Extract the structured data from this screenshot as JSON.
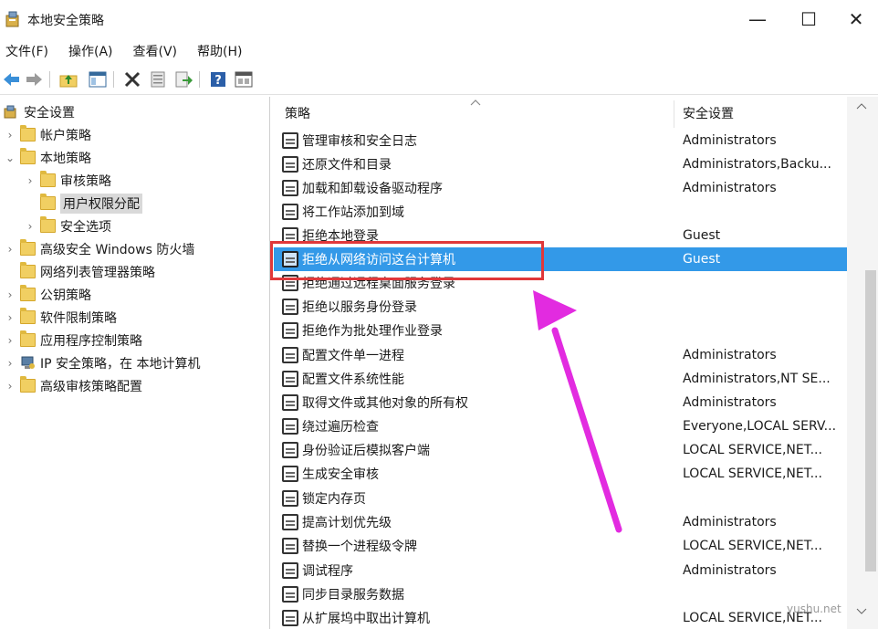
{
  "window": {
    "title": "本地安全策略",
    "minimize_glyph": "—",
    "maximize_glyph": "☐",
    "close_glyph": "✕"
  },
  "menu": [
    "文件(F)",
    "操作(A)",
    "查看(V)",
    "帮助(H)"
  ],
  "toolbar": [
    "back-icon",
    "forward-icon",
    "up-folder-icon",
    "show-hide-tree-icon",
    "delete-icon",
    "properties-icon",
    "export-list-icon",
    "help-icon",
    "console-icon"
  ],
  "tree": {
    "items": [
      {
        "label": "安全设置",
        "chevron": "",
        "icon": "security-settings-icon"
      },
      {
        "label": "帐户策略",
        "chevron": "›",
        "icon": "folder-icon"
      },
      {
        "label": "本地策略",
        "chevron": "⌄",
        "icon": "folder-icon"
      },
      {
        "label": "审核策略",
        "chevron": "›",
        "icon": "folder-icon"
      },
      {
        "label": "用户权限分配",
        "chevron": "",
        "icon": "folder-icon"
      },
      {
        "label": "安全选项",
        "chevron": "›",
        "icon": "folder-icon"
      },
      {
        "label": "高级安全 Windows 防火墙",
        "chevron": "›",
        "icon": "folder-icon"
      },
      {
        "label": "网络列表管理器策略",
        "chevron": "",
        "icon": "folder-icon"
      },
      {
        "label": "公钥策略",
        "chevron": "›",
        "icon": "folder-icon"
      },
      {
        "label": "软件限制策略",
        "chevron": "›",
        "icon": "folder-icon"
      },
      {
        "label": "应用程序控制策略",
        "chevron": "›",
        "icon": "folder-icon"
      },
      {
        "label": "IP 安全策略，在 本地计算机",
        "chevron": "›",
        "icon": "ip-security-icon"
      },
      {
        "label": "高级审核策略配置",
        "chevron": "›",
        "icon": "folder-icon"
      }
    ]
  },
  "list": {
    "columns": {
      "policy": "策略",
      "setting": "安全设置"
    },
    "rows": [
      {
        "policy": "管理审核和安全日志",
        "setting": "Administrators"
      },
      {
        "policy": "还原文件和目录",
        "setting": "Administrators,Backu..."
      },
      {
        "policy": "加载和卸载设备驱动程序",
        "setting": "Administrators"
      },
      {
        "policy": "将工作站添加到域",
        "setting": ""
      },
      {
        "policy": "拒绝本地登录",
        "setting": "Guest"
      },
      {
        "policy": "拒绝从网络访问这台计算机",
        "setting": "Guest"
      },
      {
        "policy": "拒绝通过远程桌面服务登录",
        "setting": ""
      },
      {
        "policy": "拒绝以服务身份登录",
        "setting": ""
      },
      {
        "policy": "拒绝作为批处理作业登录",
        "setting": ""
      },
      {
        "policy": "配置文件单一进程",
        "setting": "Administrators"
      },
      {
        "policy": "配置文件系统性能",
        "setting": "Administrators,NT SE..."
      },
      {
        "policy": "取得文件或其他对象的所有权",
        "setting": "Administrators"
      },
      {
        "policy": "绕过遍历检查",
        "setting": "Everyone,LOCAL SERV..."
      },
      {
        "policy": "身份验证后模拟客户端",
        "setting": "LOCAL SERVICE,NET..."
      },
      {
        "policy": "生成安全审核",
        "setting": "LOCAL SERVICE,NET..."
      },
      {
        "policy": "锁定内存页",
        "setting": ""
      },
      {
        "policy": "提高计划优先级",
        "setting": "Administrators"
      },
      {
        "policy": "替换一个进程级令牌",
        "setting": "LOCAL SERVICE,NET..."
      },
      {
        "policy": "调试程序",
        "setting": "Administrators"
      },
      {
        "policy": "同步目录服务数据",
        "setting": ""
      },
      {
        "policy": "从扩展坞中取出计算机",
        "setting": "LOCAL SERVICE,NET..."
      }
    ]
  },
  "colors": {
    "selection": "#3399e8",
    "annotation_box": "#e0383a",
    "annotation_arrow": "#e22be0"
  },
  "watermark": "yushu.net"
}
